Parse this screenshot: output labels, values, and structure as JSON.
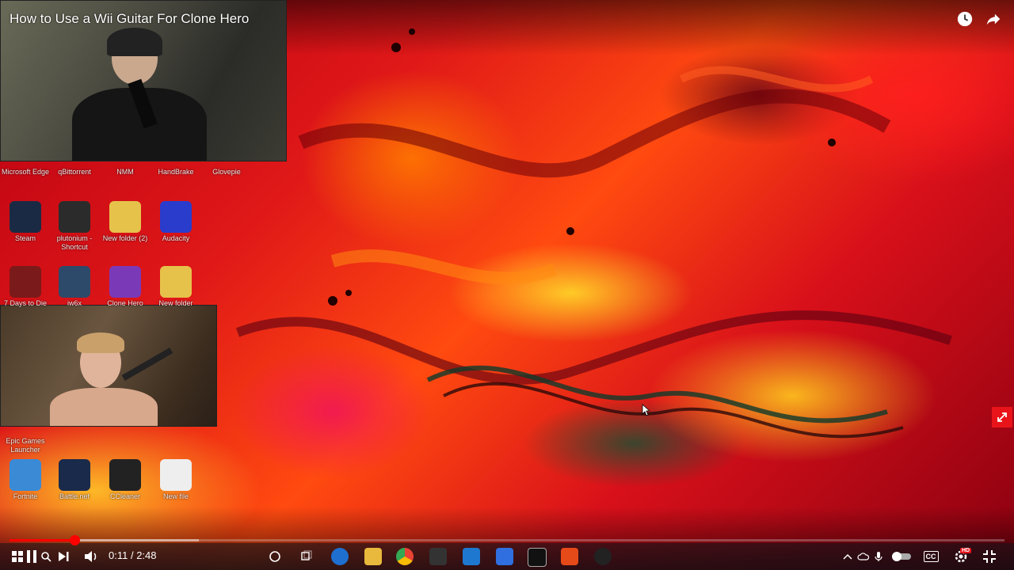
{
  "player": {
    "title": "How to Use a Wii Guitar For Clone Hero",
    "current_time": "0:11",
    "separator": " / ",
    "duration": "2:48",
    "progress_played_fraction": 0.0655,
    "progress_buffered_fraction": 0.19
  },
  "top_controls": [
    {
      "name": "watch-later-icon"
    },
    {
      "name": "share-icon"
    }
  ],
  "desktop_icons": [
    {
      "label": "Microsoft Edge",
      "color": "#1e6fd0"
    },
    {
      "label": "qBittorrent",
      "color": "#3a74c4"
    },
    {
      "label": "NMM",
      "color": "#333"
    },
    {
      "label": "HandBrake",
      "color": "#c86a1c"
    },
    {
      "label": "Glovepie",
      "color": "#555"
    },
    {
      "label": "Steam",
      "color": "#1b2a44"
    },
    {
      "label": "plutonium - Shortcut",
      "color": "#2b2b2b"
    },
    {
      "label": "New folder (2)",
      "color": "#e6c24a"
    },
    {
      "label": "Audacity",
      "color": "#2a3ccc"
    },
    {
      "label": "7 Days to Die",
      "color": "#7a1a1a"
    },
    {
      "label": "iw6x",
      "color": "#2d4a6a"
    },
    {
      "label": "Clone Hero",
      "color": "#7a3ab8"
    },
    {
      "label": "New folder",
      "color": "#e6c24a"
    },
    {
      "label": "Epic Games Launcher",
      "color": "#222"
    },
    {
      "label": "Fortnite",
      "color": "#3a8ad6"
    },
    {
      "label": "Battle.net",
      "color": "#1a2a4a"
    },
    {
      "label": "CCleaner",
      "color": "#222"
    },
    {
      "label": "New file",
      "color": "#eeeeee"
    }
  ],
  "taskbar": {
    "start_icon": "windows-icon",
    "search_icon": "search-icon",
    "cc_label": "CC",
    "hd_label": "HD"
  },
  "colors": {
    "progress_played": "#ff0000",
    "fullscreen_badge": "#e8141a"
  }
}
